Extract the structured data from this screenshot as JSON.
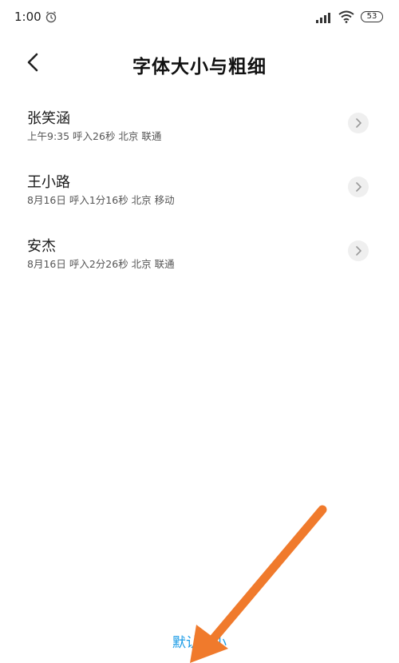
{
  "status_bar": {
    "time": "1:00",
    "battery": "53",
    "icons": [
      "alarm-icon",
      "signal-icon",
      "wifi-icon",
      "battery-icon"
    ]
  },
  "header": {
    "title": "字体大小与粗细",
    "back_icon": "chevron-left-icon"
  },
  "call_log": [
    {
      "name": "张笑涵",
      "detail": "上午9:35 呼入26秒 北京 联通"
    },
    {
      "name": "王小路",
      "detail": "8月16日 呼入1分16秒 北京 移动"
    },
    {
      "name": "安杰",
      "detail": "8月16日 呼入2分26秒 北京 联通"
    }
  ],
  "footer": {
    "default_size_label": "默认大小"
  },
  "colors": {
    "accent": "#1a9be6",
    "annotation_arrow": "#f07a2c",
    "chevron_bg": "#efefef"
  }
}
